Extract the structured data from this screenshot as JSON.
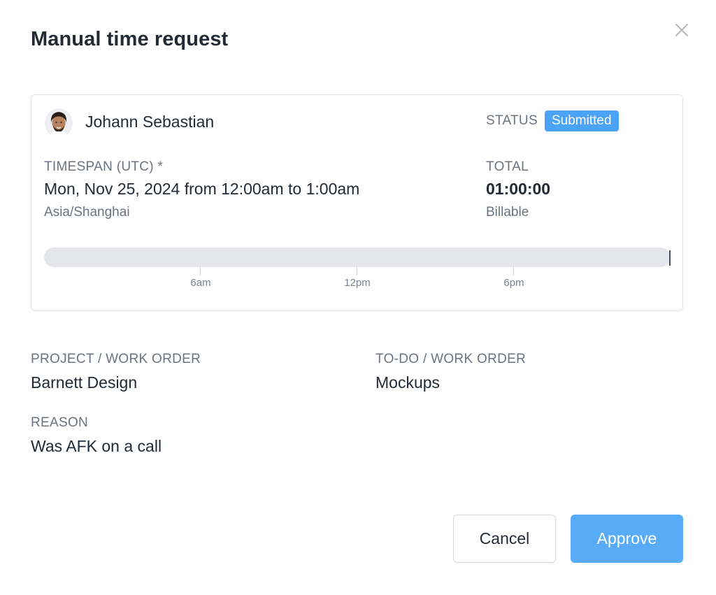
{
  "dialog": {
    "title": "Manual time request",
    "close_icon": "close-icon"
  },
  "request": {
    "user": {
      "name": "Johann Sebastian",
      "avatar_icon": "user-avatar"
    },
    "status": {
      "label": "STATUS",
      "value": "Submitted",
      "color": "#4aa3f5"
    },
    "timespan": {
      "label": "TIMESPAN (UTC) *",
      "value": "Mon, Nov 25, 2024 from 12:00am to 1:00am",
      "timezone": "Asia/Shanghai"
    },
    "total": {
      "label": "TOTAL",
      "value": "01:00:00",
      "type": "Billable"
    },
    "timeline": {
      "ticks": [
        "6am",
        "12pm",
        "6pm"
      ]
    }
  },
  "details": {
    "project": {
      "label": "PROJECT / WORK ORDER",
      "value": "Barnett Design"
    },
    "todo": {
      "label": "TO-DO / WORK ORDER",
      "value": "Mockups"
    },
    "reason": {
      "label": "REASON",
      "value": "Was AFK on a call"
    }
  },
  "actions": {
    "cancel_label": "Cancel",
    "approve_label": "Approve",
    "approve_color": "#58acf6"
  }
}
